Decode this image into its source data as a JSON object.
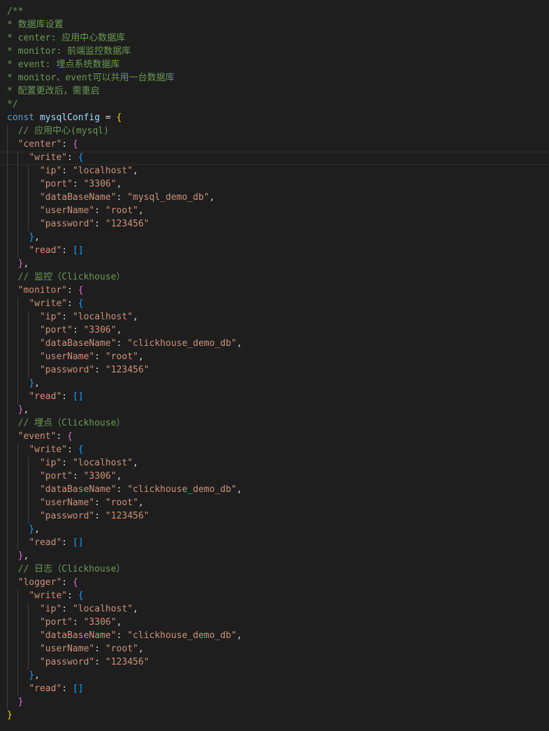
{
  "editor": {
    "lines": [
      [
        {
          "t": "/**",
          "c": "cmt"
        }
      ],
      [
        {
          "t": "* 数据库设置",
          "c": "cmt"
        }
      ],
      [
        {
          "t": "* center: 应用中心数据库",
          "c": "cmt"
        }
      ],
      [
        {
          "t": "* monitor: 前端监控数据库",
          "c": "cmt"
        }
      ],
      [
        {
          "t": "* event: 埋点系统数据库",
          "c": "cmt"
        }
      ],
      [
        {
          "t": "* monitor、event可以共用一台数据库",
          "c": "cmt"
        }
      ],
      [
        {
          "t": "* 配置更改后，需重启",
          "c": "cmt"
        }
      ],
      [
        {
          "t": "*/",
          "c": "cmt"
        }
      ],
      [
        {
          "t": "const",
          "c": "kw"
        },
        {
          "t": " ",
          "c": "op"
        },
        {
          "t": "mysqlConfig",
          "c": "var"
        },
        {
          "t": " = ",
          "c": "op"
        },
        {
          "t": "{",
          "c": "b1"
        }
      ],
      [
        {
          "t": "  ",
          "c": "op"
        },
        {
          "t": "// 应用中心(mysql)",
          "c": "cmt"
        }
      ],
      [
        {
          "t": "  ",
          "c": "op"
        },
        {
          "t": "\"center\"",
          "c": "str"
        },
        {
          "t": ": ",
          "c": "op"
        },
        {
          "t": "{",
          "c": "b2"
        }
      ],
      [
        {
          "t": "    ",
          "c": "op"
        },
        {
          "t": "\"write\"",
          "c": "str"
        },
        {
          "t": ": ",
          "c": "op"
        },
        {
          "t": "{",
          "c": "b3"
        }
      ],
      [
        {
          "t": "      ",
          "c": "op"
        },
        {
          "t": "\"ip\"",
          "c": "str"
        },
        {
          "t": ": ",
          "c": "op"
        },
        {
          "t": "\"localhost\"",
          "c": "str"
        },
        {
          "t": ",",
          "c": "op"
        }
      ],
      [
        {
          "t": "      ",
          "c": "op"
        },
        {
          "t": "\"port\"",
          "c": "str"
        },
        {
          "t": ": ",
          "c": "op"
        },
        {
          "t": "\"3306\"",
          "c": "str"
        },
        {
          "t": ",",
          "c": "op"
        }
      ],
      [
        {
          "t": "      ",
          "c": "op"
        },
        {
          "t": "\"dataBaseName\"",
          "c": "str"
        },
        {
          "t": ": ",
          "c": "op"
        },
        {
          "t": "\"mysql_demo_db\"",
          "c": "str"
        },
        {
          "t": ",",
          "c": "op"
        }
      ],
      [
        {
          "t": "      ",
          "c": "op"
        },
        {
          "t": "\"userName\"",
          "c": "str"
        },
        {
          "t": ": ",
          "c": "op"
        },
        {
          "t": "\"root\"",
          "c": "str"
        },
        {
          "t": ",",
          "c": "op"
        }
      ],
      [
        {
          "t": "      ",
          "c": "op"
        },
        {
          "t": "\"password\"",
          "c": "str"
        },
        {
          "t": ": ",
          "c": "op"
        },
        {
          "t": "\"123456\"",
          "c": "str"
        }
      ],
      [
        {
          "t": "    ",
          "c": "op"
        },
        {
          "t": "}",
          "c": "b3"
        },
        {
          "t": ",",
          "c": "op"
        }
      ],
      [
        {
          "t": "    ",
          "c": "op"
        },
        {
          "t": "\"read\"",
          "c": "str"
        },
        {
          "t": ": ",
          "c": "op"
        },
        {
          "t": "[]",
          "c": "b3"
        }
      ],
      [
        {
          "t": "  ",
          "c": "op"
        },
        {
          "t": "}",
          "c": "b2"
        },
        {
          "t": ",",
          "c": "op"
        }
      ],
      [
        {
          "t": "  ",
          "c": "op"
        },
        {
          "t": "// 监控（Clickhouse）",
          "c": "cmt"
        }
      ],
      [
        {
          "t": "  ",
          "c": "op"
        },
        {
          "t": "\"monitor\"",
          "c": "str"
        },
        {
          "t": ": ",
          "c": "op"
        },
        {
          "t": "{",
          "c": "b2"
        }
      ],
      [
        {
          "t": "    ",
          "c": "op"
        },
        {
          "t": "\"write\"",
          "c": "str"
        },
        {
          "t": ": ",
          "c": "op"
        },
        {
          "t": "{",
          "c": "b3"
        }
      ],
      [
        {
          "t": "      ",
          "c": "op"
        },
        {
          "t": "\"ip\"",
          "c": "str"
        },
        {
          "t": ": ",
          "c": "op"
        },
        {
          "t": "\"localhost\"",
          "c": "str"
        },
        {
          "t": ",",
          "c": "op"
        }
      ],
      [
        {
          "t": "      ",
          "c": "op"
        },
        {
          "t": "\"port\"",
          "c": "str"
        },
        {
          "t": ": ",
          "c": "op"
        },
        {
          "t": "\"3306\"",
          "c": "str"
        },
        {
          "t": ",",
          "c": "op"
        }
      ],
      [
        {
          "t": "      ",
          "c": "op"
        },
        {
          "t": "\"dataBaseName\"",
          "c": "str"
        },
        {
          "t": ": ",
          "c": "op"
        },
        {
          "t": "\"clickhouse_demo_db\"",
          "c": "str"
        },
        {
          "t": ",",
          "c": "op"
        }
      ],
      [
        {
          "t": "      ",
          "c": "op"
        },
        {
          "t": "\"userName\"",
          "c": "str"
        },
        {
          "t": ": ",
          "c": "op"
        },
        {
          "t": "\"root\"",
          "c": "str"
        },
        {
          "t": ",",
          "c": "op"
        }
      ],
      [
        {
          "t": "      ",
          "c": "op"
        },
        {
          "t": "\"password\"",
          "c": "str"
        },
        {
          "t": ": ",
          "c": "op"
        },
        {
          "t": "\"123456\"",
          "c": "str"
        }
      ],
      [
        {
          "t": "    ",
          "c": "op"
        },
        {
          "t": "}",
          "c": "b3"
        },
        {
          "t": ",",
          "c": "op"
        }
      ],
      [
        {
          "t": "    ",
          "c": "op"
        },
        {
          "t": "\"read\"",
          "c": "str"
        },
        {
          "t": ": ",
          "c": "op"
        },
        {
          "t": "[]",
          "c": "b3"
        }
      ],
      [
        {
          "t": "  ",
          "c": "op"
        },
        {
          "t": "}",
          "c": "b2"
        },
        {
          "t": ",",
          "c": "op"
        }
      ],
      [
        {
          "t": "  ",
          "c": "op"
        },
        {
          "t": "// 埋点（Clickhouse）",
          "c": "cmt"
        }
      ],
      [
        {
          "t": "  ",
          "c": "op"
        },
        {
          "t": "\"event\"",
          "c": "str"
        },
        {
          "t": ": ",
          "c": "op"
        },
        {
          "t": "{",
          "c": "b2"
        }
      ],
      [
        {
          "t": "    ",
          "c": "op"
        },
        {
          "t": "\"write\"",
          "c": "str"
        },
        {
          "t": ": ",
          "c": "op"
        },
        {
          "t": "{",
          "c": "b3"
        }
      ],
      [
        {
          "t": "      ",
          "c": "op"
        },
        {
          "t": "\"ip\"",
          "c": "str"
        },
        {
          "t": ": ",
          "c": "op"
        },
        {
          "t": "\"localhost\"",
          "c": "str"
        },
        {
          "t": ",",
          "c": "op"
        }
      ],
      [
        {
          "t": "      ",
          "c": "op"
        },
        {
          "t": "\"port\"",
          "c": "str"
        },
        {
          "t": ": ",
          "c": "op"
        },
        {
          "t": "\"3306\"",
          "c": "str"
        },
        {
          "t": ",",
          "c": "op"
        }
      ],
      [
        {
          "t": "      ",
          "c": "op"
        },
        {
          "t": "\"dataBaseName\"",
          "c": "str"
        },
        {
          "t": ": ",
          "c": "op"
        },
        {
          "t": "\"clickhouse_demo_db\"",
          "c": "str"
        },
        {
          "t": ",",
          "c": "op"
        }
      ],
      [
        {
          "t": "      ",
          "c": "op"
        },
        {
          "t": "\"userName\"",
          "c": "str"
        },
        {
          "t": ": ",
          "c": "op"
        },
        {
          "t": "\"root\"",
          "c": "str"
        },
        {
          "t": ",",
          "c": "op"
        }
      ],
      [
        {
          "t": "      ",
          "c": "op"
        },
        {
          "t": "\"password\"",
          "c": "str"
        },
        {
          "t": ": ",
          "c": "op"
        },
        {
          "t": "\"123456\"",
          "c": "str"
        }
      ],
      [
        {
          "t": "    ",
          "c": "op"
        },
        {
          "t": "}",
          "c": "b3"
        },
        {
          "t": ",",
          "c": "op"
        }
      ],
      [
        {
          "t": "    ",
          "c": "op"
        },
        {
          "t": "\"read\"",
          "c": "str"
        },
        {
          "t": ": ",
          "c": "op"
        },
        {
          "t": "[]",
          "c": "b3"
        }
      ],
      [
        {
          "t": "  ",
          "c": "op"
        },
        {
          "t": "}",
          "c": "b2"
        },
        {
          "t": ",",
          "c": "op"
        }
      ],
      [
        {
          "t": "  ",
          "c": "op"
        },
        {
          "t": "// 日志（Clickhouse）",
          "c": "cmt"
        }
      ],
      [
        {
          "t": "  ",
          "c": "op"
        },
        {
          "t": "\"logger\"",
          "c": "str"
        },
        {
          "t": ": ",
          "c": "op"
        },
        {
          "t": "{",
          "c": "b2"
        }
      ],
      [
        {
          "t": "    ",
          "c": "op"
        },
        {
          "t": "\"write\"",
          "c": "str"
        },
        {
          "t": ": ",
          "c": "op"
        },
        {
          "t": "{",
          "c": "b3"
        }
      ],
      [
        {
          "t": "      ",
          "c": "op"
        },
        {
          "t": "\"ip\"",
          "c": "str"
        },
        {
          "t": ": ",
          "c": "op"
        },
        {
          "t": "\"localhost\"",
          "c": "str"
        },
        {
          "t": ",",
          "c": "op"
        }
      ],
      [
        {
          "t": "      ",
          "c": "op"
        },
        {
          "t": "\"port\"",
          "c": "str"
        },
        {
          "t": ": ",
          "c": "op"
        },
        {
          "t": "\"3306\"",
          "c": "str"
        },
        {
          "t": ",",
          "c": "op"
        }
      ],
      [
        {
          "t": "      ",
          "c": "op"
        },
        {
          "t": "\"dataBaseName\"",
          "c": "str"
        },
        {
          "t": ": ",
          "c": "op"
        },
        {
          "t": "\"clickhouse_demo_db\"",
          "c": "str"
        },
        {
          "t": ",",
          "c": "op"
        }
      ],
      [
        {
          "t": "      ",
          "c": "op"
        },
        {
          "t": "\"userName\"",
          "c": "str"
        },
        {
          "t": ": ",
          "c": "op"
        },
        {
          "t": "\"root\"",
          "c": "str"
        },
        {
          "t": ",",
          "c": "op"
        }
      ],
      [
        {
          "t": "      ",
          "c": "op"
        },
        {
          "t": "\"password\"",
          "c": "str"
        },
        {
          "t": ": ",
          "c": "op"
        },
        {
          "t": "\"123456\"",
          "c": "str"
        }
      ],
      [
        {
          "t": "    ",
          "c": "op"
        },
        {
          "t": "}",
          "c": "b3"
        },
        {
          "t": ",",
          "c": "op"
        }
      ],
      [
        {
          "t": "    ",
          "c": "op"
        },
        {
          "t": "\"read\"",
          "c": "str"
        },
        {
          "t": ": ",
          "c": "op"
        },
        {
          "t": "[]",
          "c": "b3"
        }
      ],
      [
        {
          "t": "  ",
          "c": "op"
        },
        {
          "t": "}",
          "c": "b2"
        }
      ],
      [
        {
          "t": "}",
          "c": "b1"
        }
      ]
    ]
  }
}
